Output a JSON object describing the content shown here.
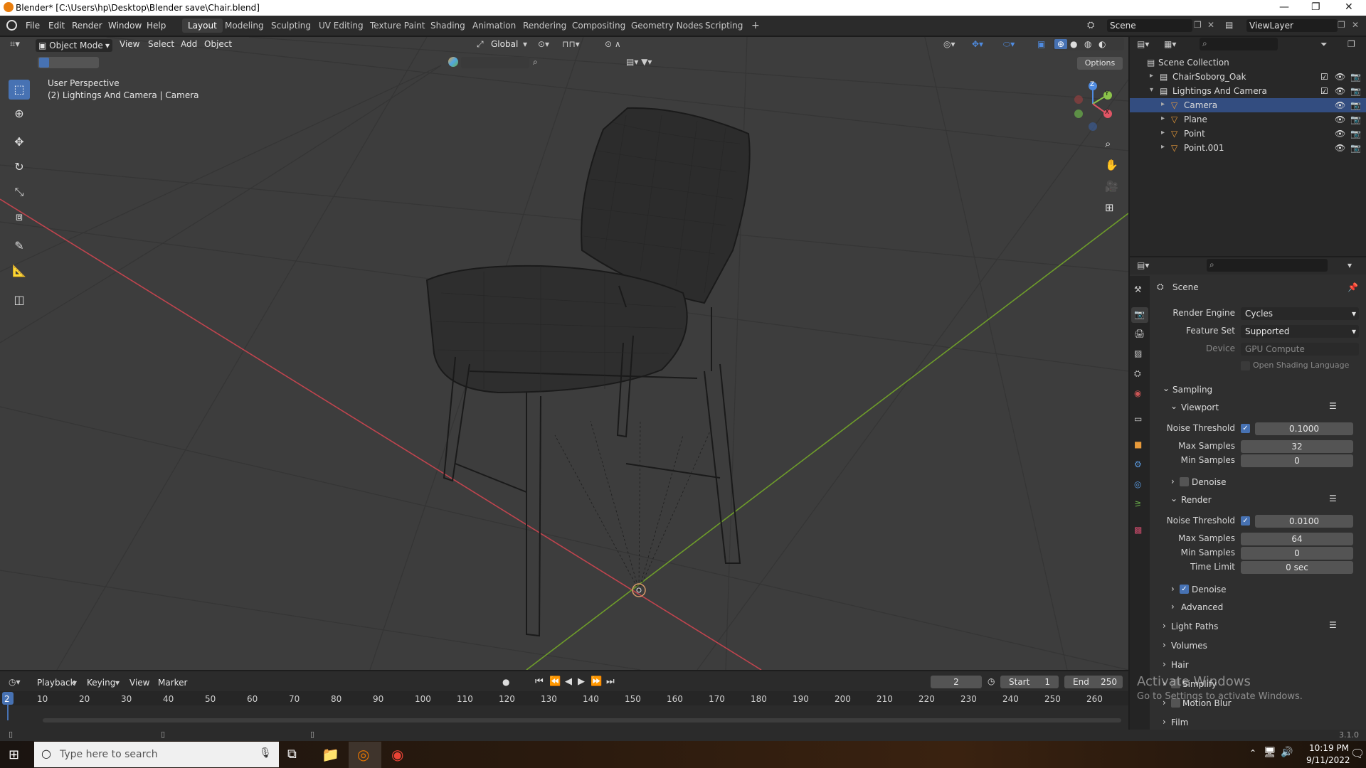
{
  "window": {
    "title": "Blender* [C:\\Users\\hp\\Desktop\\Blender save\\Chair.blend]",
    "controls": [
      "—",
      "❐",
      "✕"
    ]
  },
  "menu": {
    "items": [
      "File",
      "Edit",
      "Render",
      "Window",
      "Help"
    ],
    "workspaces": [
      "Layout",
      "Modeling",
      "Sculpting",
      "UV Editing",
      "Texture Paint",
      "Shading",
      "Animation",
      "Rendering",
      "Compositing",
      "Geometry Nodes",
      "Scripting"
    ],
    "active_workspace": "Layout",
    "add_tab": "+",
    "scene": "Scene",
    "view_layer": "ViewLayer"
  },
  "viewport": {
    "mode": "Object Mode",
    "menus": [
      "View",
      "Select",
      "Add",
      "Object"
    ],
    "orientation": "Global",
    "options": "Options",
    "info_line1": "User Perspective",
    "info_line2": "(2) Lightings And Camera | Camera",
    "gizmo_axes": [
      "Z",
      "Y",
      "X"
    ]
  },
  "outliner": {
    "root": "Scene Collection",
    "rows": [
      {
        "label": "ChairSoborg_Oak",
        "indent": 1,
        "selected": false
      },
      {
        "label": "Lightings And Camera",
        "indent": 1,
        "selected": false
      },
      {
        "label": "Camera",
        "indent": 2,
        "selected": true
      },
      {
        "label": "Plane",
        "indent": 2,
        "selected": false
      },
      {
        "label": "Point",
        "indent": 2,
        "selected": false
      },
      {
        "label": "Point.001",
        "indent": 2,
        "selected": false
      }
    ]
  },
  "properties": {
    "header": "Scene",
    "render_engine_label": "Render Engine",
    "render_engine": "Cycles",
    "feature_set_label": "Feature Set",
    "feature_set": "Supported",
    "device_label": "Device",
    "device": "GPU Compute",
    "osl_label": "Open Shading Language",
    "sampling": "Sampling",
    "viewport_sub": "Viewport",
    "noise_threshold_label": "Noise Threshold",
    "viewport_noise": "0.1000",
    "max_samples_label": "Max Samples",
    "viewport_max": "32",
    "min_samples_label": "Min Samples",
    "viewport_min": "0",
    "denoise_label": "Denoise",
    "render_sub": "Render",
    "render_noise": "0.0100",
    "render_max": "64",
    "render_min": "0",
    "time_limit_label": "Time Limit",
    "time_limit": "0 sec",
    "advanced": "Advanced",
    "light_paths": "Light Paths",
    "volumes": "Volumes",
    "hair": "Hair",
    "simplify": "Simplify",
    "motion_blur": "Motion Blur",
    "film": "Film",
    "version": "3.1.0"
  },
  "watermark": {
    "line1": "Activate Windows",
    "line2": "Go to Settings to activate Windows."
  },
  "timeline": {
    "menus": [
      "Playback",
      "Keying",
      "View",
      "Marker"
    ],
    "current_frame": "2",
    "start_label": "Start",
    "start": "1",
    "end_label": "End",
    "end": "250",
    "ticks": [
      "2",
      "10",
      "20",
      "30",
      "40",
      "50",
      "60",
      "70",
      "80",
      "90",
      "100",
      "110",
      "120",
      "130",
      "140",
      "150",
      "160",
      "170",
      "180",
      "190",
      "200",
      "210",
      "220",
      "230",
      "240",
      "250",
      "260"
    ]
  },
  "taskbar": {
    "search_placeholder": "Type here to search",
    "time": "10:19 PM",
    "date": "9/11/2022"
  }
}
